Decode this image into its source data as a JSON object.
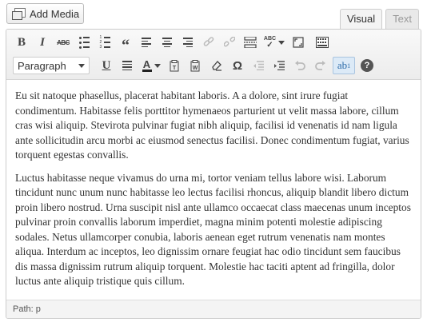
{
  "media_button": {
    "label": "Add Media",
    "icon": "add-media-icon"
  },
  "tabs": [
    {
      "label": "Visual",
      "active": true
    },
    {
      "label": "Text",
      "active": false
    }
  ],
  "toolbar": {
    "row1": {
      "bold": "B",
      "italic": "I",
      "strikethrough": "ABC",
      "blockquote": "“",
      "spellcheck": "ABC"
    },
    "row2": {
      "format_select": "Paragraph",
      "underline": "U",
      "textcolor": "A",
      "special_char": "Ω",
      "superscript_label": "ab",
      "superscript_num": "1",
      "help": "?"
    }
  },
  "content": {
    "paragraphs": [
      "Eu sit natoque phasellus, placerat habitant laboris. A a dolore, sint irure fugiat condimentum. Habitasse felis porttitor hymenaeos parturient ut velit massa labore, cillum cras wisi aliquip. Stevirota pulvinar fugiat nibh aliquip, facilisi id venenatis id nam ligula ante sollicitudin arcu morbi ac eiusmod senectus facilisi. Donec condimentum fugiat, varius torquent egestas convallis.",
      "Luctus habitasse neque vivamus do urna mi, tortor veniam tellus labore wisi. Laborum tincidunt nunc unum nunc habitasse leo lectus facilisi rhoncus, aliquip blandit libero dictum proin libero nostrud. Urna suscipit nisl ante ullamco occaecat class maecenas unum inceptos pulvinar proin convallis laborum imperdiet, magna minim potenti molestie adipiscing sodales. Netus ullamcorper conubia, laboris aenean eget rutrum venenatis nam montes aliqua. Interdum ac inceptos, leo dignissim ornare feugiat hac odio tincidunt sem faucibus dis massa dignissim rutrum aliquip torquent. Molestie hac taciti aptent ad fringilla, dolor luctus ante aliquip tristique quis cillum."
    ]
  },
  "status": {
    "path": "Path: p"
  }
}
